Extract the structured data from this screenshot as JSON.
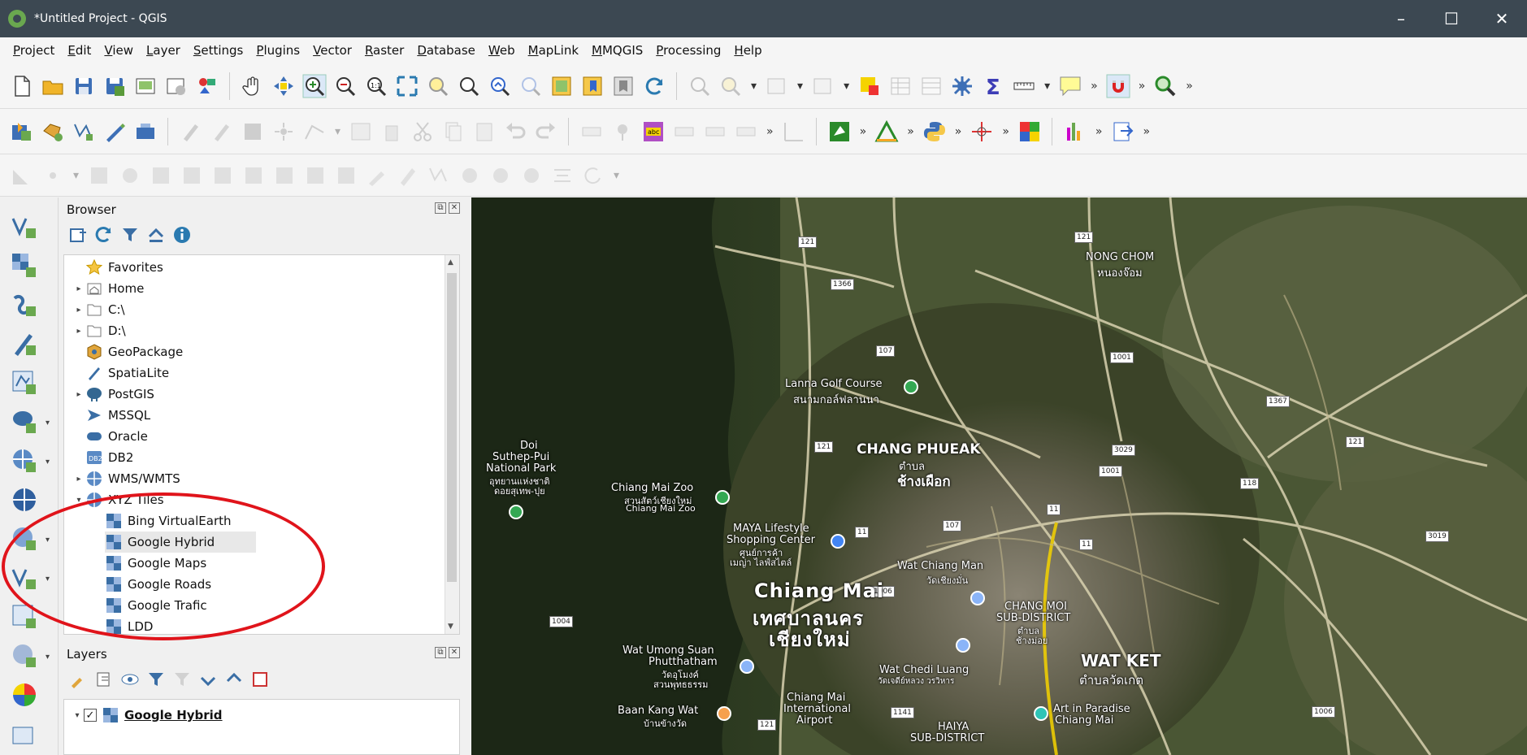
{
  "window": {
    "title": "*Untitled Project - QGIS",
    "minimize": "–",
    "maximize": "☐",
    "close": "✕"
  },
  "menu": [
    "Project",
    "Edit",
    "View",
    "Layer",
    "Settings",
    "Plugins",
    "Vector",
    "Raster",
    "Database",
    "Web",
    "MapLink",
    "MMQGIS",
    "Processing",
    "Help"
  ],
  "toolbar_more": "»",
  "browser": {
    "title": "Browser",
    "items": [
      {
        "label": "Favorites",
        "icon": "star-icon",
        "caret": ""
      },
      {
        "label": "Home",
        "icon": "home-folder-icon",
        "caret": "▸"
      },
      {
        "label": "C:\\",
        "icon": "folder-icon",
        "caret": "▸"
      },
      {
        "label": "D:\\",
        "icon": "folder-icon",
        "caret": "▸"
      },
      {
        "label": "GeoPackage",
        "icon": "geopackage-icon",
        "caret": ""
      },
      {
        "label": "SpatiaLite",
        "icon": "spatialite-icon",
        "caret": ""
      },
      {
        "label": "PostGIS",
        "icon": "postgis-icon",
        "caret": "▸"
      },
      {
        "label": "MSSQL",
        "icon": "mssql-icon",
        "caret": ""
      },
      {
        "label": "Oracle",
        "icon": "oracle-icon",
        "caret": ""
      },
      {
        "label": "DB2",
        "icon": "db2-icon",
        "caret": ""
      },
      {
        "label": "WMS/WMTS",
        "icon": "wms-icon",
        "caret": "▸"
      },
      {
        "label": "XYZ Tiles",
        "icon": "xyz-tiles-icon",
        "caret": "▾"
      },
      {
        "label": "Bing VirtualEarth",
        "icon": "xyz-layer-icon",
        "caret": ""
      },
      {
        "label": "Google Hybrid",
        "icon": "xyz-layer-icon",
        "caret": ""
      },
      {
        "label": "Google Maps",
        "icon": "xyz-layer-icon",
        "caret": ""
      },
      {
        "label": "Google Roads",
        "icon": "xyz-layer-icon",
        "caret": ""
      },
      {
        "label": "Google Trafic",
        "icon": "xyz-layer-icon",
        "caret": ""
      },
      {
        "label": "LDD",
        "icon": "xyz-layer-icon",
        "caret": ""
      }
    ]
  },
  "layers": {
    "title": "Layers",
    "items": [
      {
        "label": "Google Hybrid",
        "checked": "✓",
        "caret": "▾"
      }
    ]
  },
  "map": {
    "labels": {
      "nong_chom": "NONG CHOM",
      "nong_chom_th": "หนองจ๊อม",
      "lanna_golf": "Lanna Golf Course",
      "lanna_golf_th": "สนามกอล์ฟลานนา",
      "chang_phueak": "CHANG PHUEAK",
      "chang_phueak_th1": "ตำบล",
      "chang_phueak_th2": "ช้างเผือก",
      "doi_suthep": "Doi",
      "doi_suthep2": "Suthep-Pui",
      "doi_suthep3": "National Park",
      "doi_suthep_th": "อุทยานแห่งชาติ",
      "doi_suthep_th2": "ดอยสุเทพ-ปุย",
      "chiang_mai_zoo": "Chiang Mai Zoo",
      "chiang_mai_zoo_th": "สวนสัตว์เชียงใหม่",
      "chiang_mai_zoo2": "Chiang Mai Zoo",
      "maya": "MAYA Lifestyle",
      "maya2": "Shopping Center",
      "maya_th": "ศูนย์การค้า",
      "maya_th2": "เมญ่า ไลฟ์สไตล์",
      "wat_chiang_mon": "Wat Chiang Man",
      "wat_chiang_mon_th": "วัดเชียงมั่น",
      "chiang_mai": "Chiang Mai",
      "chiang_mai_th": "เทศบาลนคร",
      "chiang_mai_th2": "เชียงใหม่",
      "chang_moi": "CHANG MOI",
      "chang_moi2": "SUB-DISTRICT",
      "chang_moi_th": "ตำบล",
      "chang_moi_th2": "ช้างม่อย",
      "wat_ket": "WAT KET",
      "wat_ket_th": "ตำบลวัดเกต",
      "wat_umong": "Wat Umong Suan",
      "wat_umong2": "Phutthatham",
      "wat_umong_th": "วัดอุโมงค์",
      "wat_umong_th2": "สวนพุทธธรรม",
      "wat_chedi": "Wat Chedi Luang",
      "wat_chedi_th": "วัดเจดีย์หลวง วรวิหาร",
      "baan_kang_wat": "Baan Kang Wat",
      "baan_kang_wat_th": "บ้านข้างวัด",
      "airport": "Chiang Mai",
      "airport2": "International",
      "airport3": "Airport",
      "haiya": "HAIYA",
      "haiya2": "SUB-DISTRICT",
      "art_paradise": "Art in Paradise",
      "art_paradise2": "Chiang Mai"
    },
    "roads": [
      "121",
      "121",
      "1366",
      "107",
      "1001",
      "1367",
      "121",
      "121",
      "3029",
      "1001",
      "118",
      "11",
      "11",
      "107",
      "1006",
      "11",
      "1004",
      "1141",
      "121",
      "1006",
      "3019"
    ]
  }
}
